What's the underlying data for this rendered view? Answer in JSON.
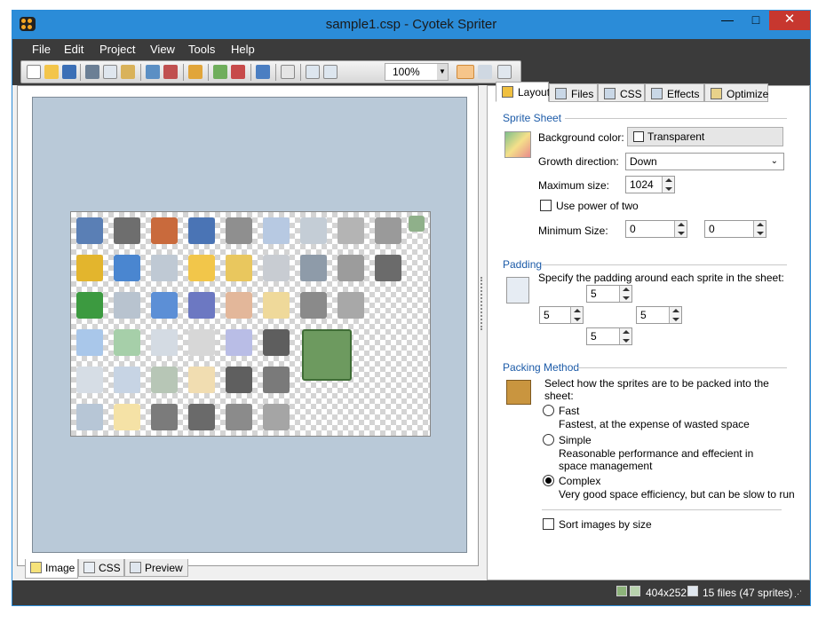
{
  "window": {
    "title": "sample1.csp - Cyotek Spriter",
    "minimize": "—",
    "maximize": "□",
    "close": "✕"
  },
  "menu": [
    "File",
    "Edit",
    "Project",
    "View",
    "Tools",
    "Help"
  ],
  "toolbar": {
    "zoom_value": "100%",
    "zoom_dropdown": "▼"
  },
  "left_tabs": [
    {
      "label": "Image",
      "icon": "image-icon"
    },
    {
      "label": "CSS",
      "icon": "css-icon"
    },
    {
      "label": "Preview",
      "icon": "preview-icon"
    }
  ],
  "right_tabs": [
    {
      "label": "Layout",
      "icon": "layout-icon"
    },
    {
      "label": "Files",
      "icon": "files-icon"
    },
    {
      "label": "CSS",
      "icon": "css-icon"
    },
    {
      "label": "Effects",
      "icon": "effects-icon"
    },
    {
      "label": "Optimize",
      "icon": "optimize-icon"
    }
  ],
  "sprite_sheet": {
    "heading": "Sprite Sheet",
    "background_color_label": "Background color:",
    "background_color_value": "Transparent",
    "growth_direction_label": "Growth direction:",
    "growth_direction_value": "Down",
    "maximum_size_label": "Maximum size:",
    "maximum_size_value": "1024",
    "use_power_of_two_label": "Use power of two",
    "use_power_of_two_checked": false,
    "minimum_size_label": "Minimum Size:",
    "minimum_width": "0",
    "minimum_height": "0"
  },
  "padding": {
    "heading": "Padding",
    "description": "Specify the padding around each sprite in the sheet:",
    "top": "5",
    "left": "5",
    "right": "5",
    "bottom": "5"
  },
  "packing": {
    "heading": "Packing Method",
    "description": "Select how the sprites are to be packed into the sheet:",
    "options": [
      {
        "label": "Fast",
        "desc": "Fastest, at the expense of wasted space",
        "selected": false
      },
      {
        "label": "Simple",
        "desc": "Reasonable performance and effecient in space management",
        "selected": false
      },
      {
        "label": "Complex",
        "desc": "Very good space efficiency, but can be slow to run",
        "selected": true
      }
    ],
    "sort_label": "Sort images by size",
    "sort_checked": false
  },
  "status": {
    "dimensions": "404x252",
    "files": "15 files (47 sprites)"
  },
  "colors": {
    "titlebar": "#2b8cd8",
    "dark_bars": "#3b3b3b",
    "canvas": "#b9c9d8",
    "section_heading": "#1c5ba8",
    "close_button": "#c7372f"
  }
}
